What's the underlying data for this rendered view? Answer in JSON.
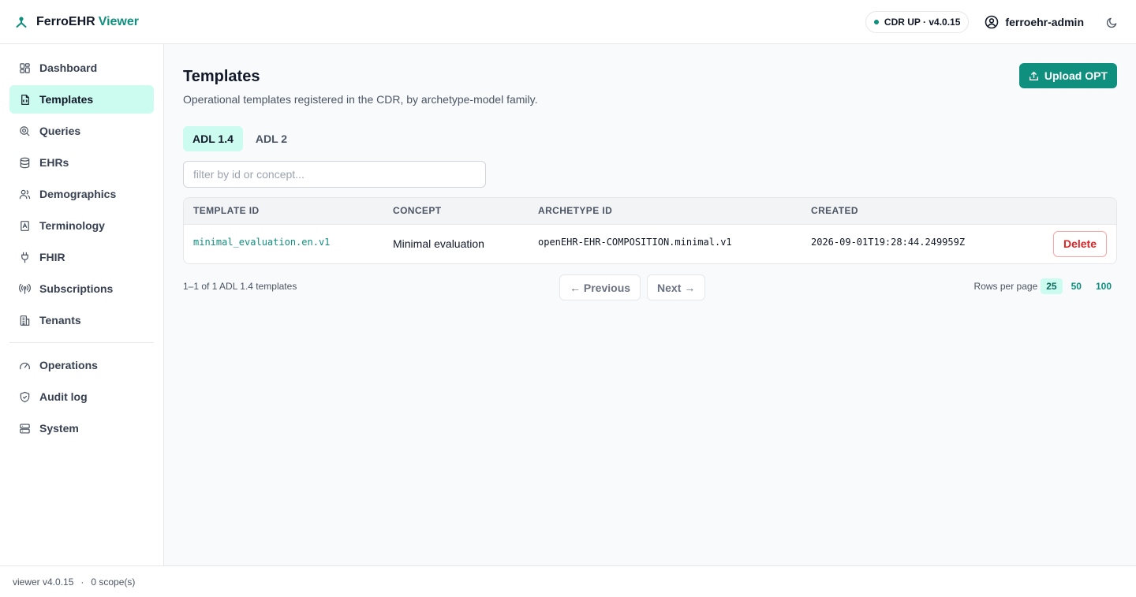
{
  "header": {
    "brand_name": "FerroEHR",
    "brand_accent": "Viewer",
    "status": "CDR UP · v4.0.15",
    "user": "ferroehr-admin"
  },
  "sidebar": {
    "items": [
      {
        "label": "Dashboard",
        "icon": "dashboard-icon"
      },
      {
        "label": "Templates",
        "icon": "template-icon",
        "active": true
      },
      {
        "label": "Queries",
        "icon": "query-icon"
      },
      {
        "label": "EHRs",
        "icon": "database-icon"
      },
      {
        "label": "Demographics",
        "icon": "people-icon"
      },
      {
        "label": "Terminology",
        "icon": "book-icon"
      },
      {
        "label": "FHIR",
        "icon": "plug-icon"
      },
      {
        "label": "Subscriptions",
        "icon": "broadcast-icon"
      },
      {
        "label": "Tenants",
        "icon": "building-icon"
      }
    ],
    "secondary_items": [
      {
        "label": "Operations",
        "icon": "gauge-icon"
      },
      {
        "label": "Audit log",
        "icon": "shield-icon"
      },
      {
        "label": "System",
        "icon": "server-icon"
      }
    ]
  },
  "main": {
    "title": "Templates",
    "subtitle": "Operational templates registered in the CDR, by archetype-model family.",
    "upload_label": "Upload OPT",
    "tabs": [
      {
        "label": "ADL 1.4",
        "active": true
      },
      {
        "label": "ADL 2"
      }
    ],
    "filter_placeholder": "filter by id or concept...",
    "table": {
      "columns": [
        "TEMPLATE ID",
        "CONCEPT",
        "ARCHETYPE ID",
        "CREATED"
      ],
      "rows": [
        {
          "template_id": "minimal_evaluation.en.v1",
          "concept": "Minimal evaluation",
          "archetype_id": "openEHR-EHR-COMPOSITION.minimal.v1",
          "created": "2026-09-01T19:28:44.249959Z",
          "action": "Delete"
        }
      ]
    },
    "pager": {
      "info": "1–1 of 1 ADL 1.4 templates",
      "previous": "← Previous",
      "next": "Next →",
      "rows_label": "Rows per page",
      "rows_options": [
        "25",
        "50",
        "100"
      ],
      "rows_selected": "25"
    }
  },
  "footer": {
    "version": "viewer v4.0.15",
    "separator": "·",
    "scopes": "0 scope(s)"
  },
  "colors": {
    "accent": "#0f8f7e",
    "accent_soft": "#ccfbef",
    "danger": "#dc2626"
  }
}
